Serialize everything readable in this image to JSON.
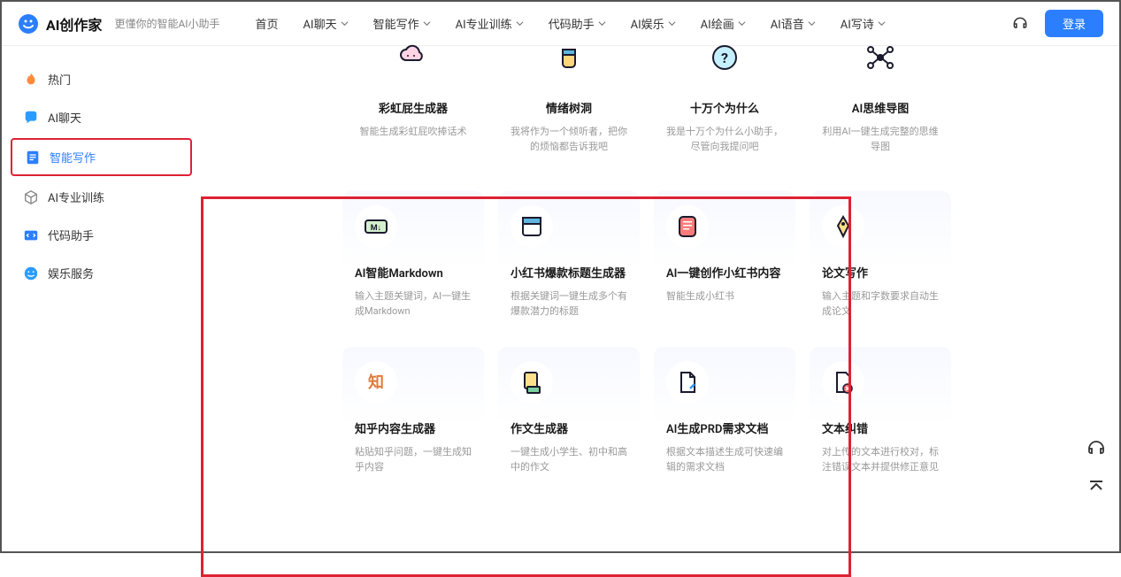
{
  "header": {
    "brand": "AI创作家",
    "subtitle": "更懂你的智能AI小助手",
    "nav": [
      "首页",
      "AI聊天",
      "智能写作",
      "AI专业训练",
      "代码助手",
      "AI娱乐",
      "AI绘画",
      "AI语音",
      "AI写诗"
    ],
    "login": "登录"
  },
  "sidebar": {
    "items": [
      {
        "label": "热门"
      },
      {
        "label": "AI聊天"
      },
      {
        "label": "智能写作"
      },
      {
        "label": "AI专业训练"
      },
      {
        "label": "代码助手"
      },
      {
        "label": "娱乐服务"
      }
    ]
  },
  "topRow": [
    {
      "title": "彩虹屁生成器",
      "desc": "智能生成彩虹屁吹捧话术"
    },
    {
      "title": "情绪树洞",
      "desc": "我将作为一个倾听者，把你的烦恼都告诉我吧"
    },
    {
      "title": "十万个为什么",
      "desc": "我是十万个为什么小助手，尽管向我提问吧"
    },
    {
      "title": "AI思维导图",
      "desc": "利用AI一键生成完整的思维导图"
    }
  ],
  "cards": [
    {
      "title": "AI智能Markdown",
      "desc": "输入主题关键词，AI一键生成Markdown"
    },
    {
      "title": "小红书爆款标题生成器",
      "desc": "根据关键词一键生成多个有爆款潜力的标题"
    },
    {
      "title": "AI一键创作小红书内容",
      "desc": "智能生成小红书"
    },
    {
      "title": "论文写作",
      "desc": "输入主题和字数要求自动生成论文"
    },
    {
      "title": "知乎内容生成器",
      "desc": "粘贴知乎问题，一键生成知乎内容"
    },
    {
      "title": "作文生成器",
      "desc": "一键生成小学生、初中和高中的作文"
    },
    {
      "title": "AI生成PRD需求文档",
      "desc": "根据文本描述生成可快速编辑的需求文档"
    },
    {
      "title": "文本纠错",
      "desc": "对上传的文本进行校对，标注错误文本并提供修正意见"
    }
  ]
}
